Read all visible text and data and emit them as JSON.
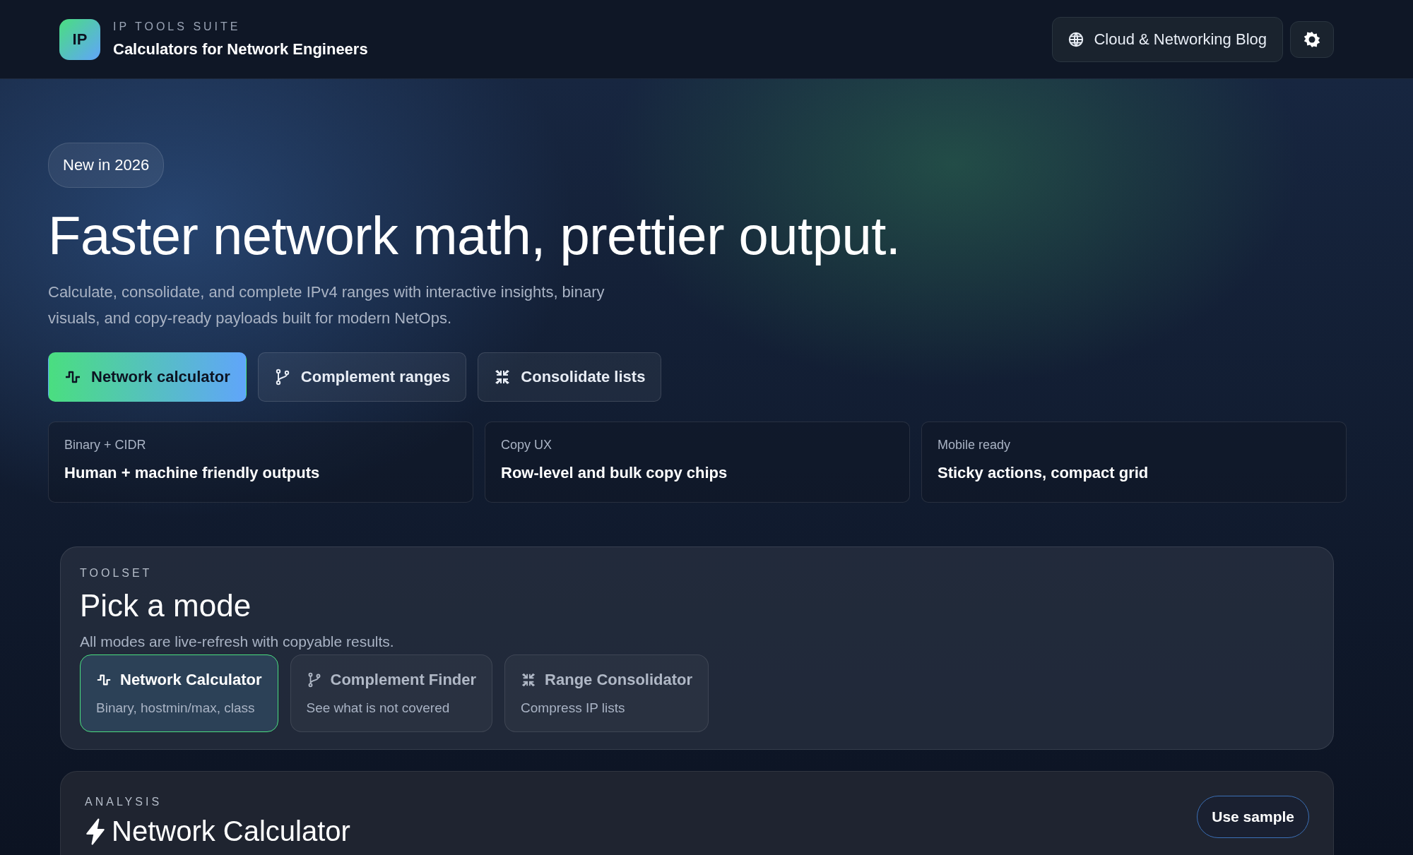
{
  "header": {
    "logo": "IP",
    "eyebrow": "IP TOOLS SUITE",
    "title": "Calculators for Network Engineers",
    "blog_link": "Cloud & Networking Blog"
  },
  "hero": {
    "badge": "New in 2026",
    "heading": "Faster network math, prettier output.",
    "subtitle": "Calculate, consolidate, and complete IPv4 ranges with interactive insights, binary visuals, and copy-ready payloads built for modern NetOps.",
    "actions": [
      {
        "label": "Network calculator",
        "selected": true
      },
      {
        "label": "Complement ranges",
        "selected": false
      },
      {
        "label": "Consolidate lists",
        "selected": false
      }
    ],
    "features": [
      {
        "caption": "Binary + CIDR",
        "title": "Human + machine friendly outputs"
      },
      {
        "caption": "Copy UX",
        "title": "Row-level and bulk copy chips"
      },
      {
        "caption": "Mobile ready",
        "title": "Sticky actions, compact grid"
      }
    ]
  },
  "toolset": {
    "eyebrow": "TOOLSET",
    "title": "Pick a mode",
    "subtitle": "All modes are live-refresh with copyable results.",
    "modes": [
      {
        "title": "Network Calculator",
        "description": "Binary, hostmin/max, class",
        "selected": true
      },
      {
        "title": "Complement Finder",
        "description": "See what is not covered",
        "selected": false
      },
      {
        "title": "Range Consolidator",
        "description": "Compress IP lists",
        "selected": false
      }
    ]
  },
  "analysis": {
    "eyebrow": "ANALYSIS",
    "title": "Network Calculator",
    "sample_button": "Use sample"
  }
}
